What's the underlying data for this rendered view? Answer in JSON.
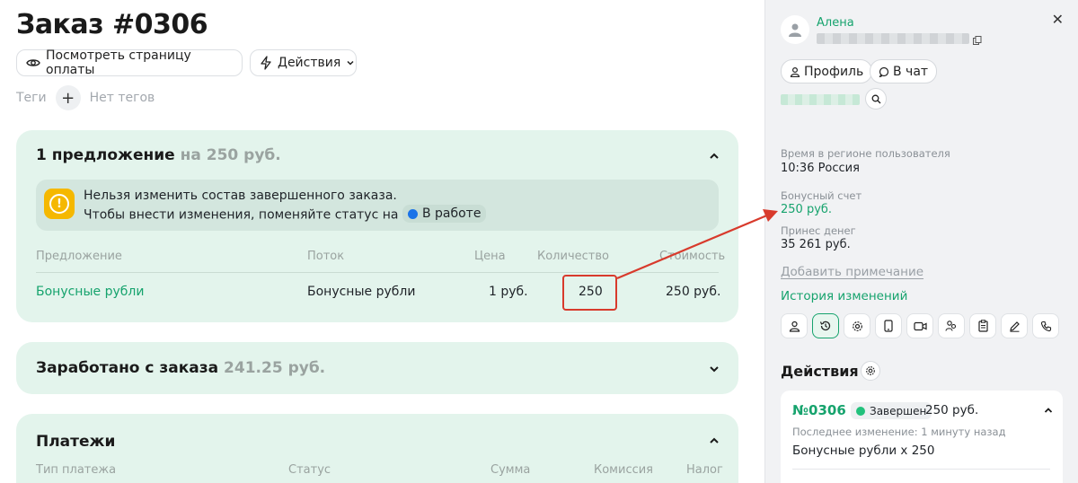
{
  "order": {
    "title": "Заказ #0306",
    "view_payment_label": "Посмотреть страницу оплаты",
    "actions_label": "Действия",
    "tags_label": "Теги",
    "no_tags": "Нет тегов"
  },
  "offers_card": {
    "title": "1 предложение",
    "title_amount": "на 250 руб.",
    "warning_line1": "Нельзя изменить состав завершенного заказа.",
    "warning_line2": "Чтобы внести изменения, поменяйте статус на",
    "status_chip": "В работе",
    "columns": [
      "Предложение",
      "Поток",
      "Цена",
      "Количество",
      "Стоимость"
    ],
    "row": {
      "offer": "Бонусные рубли",
      "stream": "Бонусные рубли",
      "price": "1 руб.",
      "quantity": "250",
      "cost": "250 руб."
    }
  },
  "earned_card": {
    "title": "Заработано с заказа",
    "amount": "241.25 руб."
  },
  "payments_card": {
    "title": "Платежи",
    "columns": [
      "Тип платежа",
      "Статус",
      "Сумма",
      "Комиссия",
      "Налог"
    ]
  },
  "user_panel": {
    "name": "Алена",
    "profile_label": "Профиль",
    "chat_label": "В чат",
    "region_time_label": "Время в регионе пользователя",
    "region_time_value": "10:36  Россия",
    "bonus_label": "Бонусный счет",
    "bonus_value": "250 руб.",
    "revenue_label": "Принес денег",
    "revenue_value": "35 261 руб.",
    "add_note": "Добавить примечание",
    "history": "История изменений",
    "tab_icons": [
      "user-icon",
      "history-icon",
      "settings-icon",
      "phone-device-icon",
      "video-icon",
      "users-icon",
      "clipboard-icon",
      "pen-icon",
      "call-icon"
    ],
    "actions_heading": "Действия",
    "order_card": {
      "number": "№0306",
      "status": "Завершен",
      "sum": "250 руб.",
      "last_change": "Последнее изменение: 1 минуту назад",
      "item": "Бонусные рубли x 250"
    }
  },
  "colors": {
    "accent_green": "#16a36d",
    "card_bg": "#e3f4ec",
    "warning_yellow": "#f5b800",
    "annotation_red": "#d83a2c",
    "status_blue": "#1a73e8"
  }
}
